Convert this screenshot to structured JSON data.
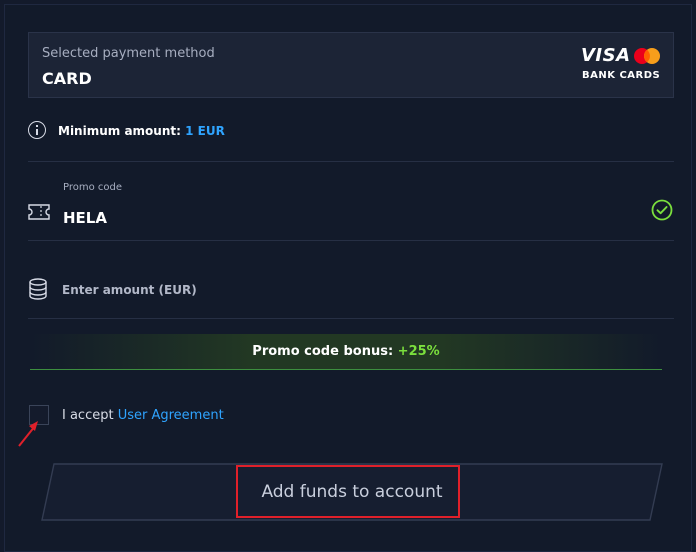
{
  "payment_method": {
    "label": "Selected payment method",
    "value": "CARD",
    "brand_visa": "VISA",
    "brand_caption": "BANK CARDS"
  },
  "minimum": {
    "label": "Minimum amount:",
    "value": "1 EUR"
  },
  "promo": {
    "label": "Promo code",
    "value": "HELA",
    "status_icon": "check-circle-icon"
  },
  "amount": {
    "placeholder": "Enter amount (EUR)",
    "value": ""
  },
  "bonus": {
    "label": "Promo code bonus:",
    "value": "+25%"
  },
  "agreement": {
    "prefix": "I accept",
    "link": "User Agreement",
    "checked": false
  },
  "cta": {
    "label": "Add funds to account"
  },
  "colors": {
    "background": "#131a2b",
    "accent_blue": "#2fa4ff",
    "accent_green": "#7bdf3d",
    "highlight_red": "#e0202a"
  }
}
